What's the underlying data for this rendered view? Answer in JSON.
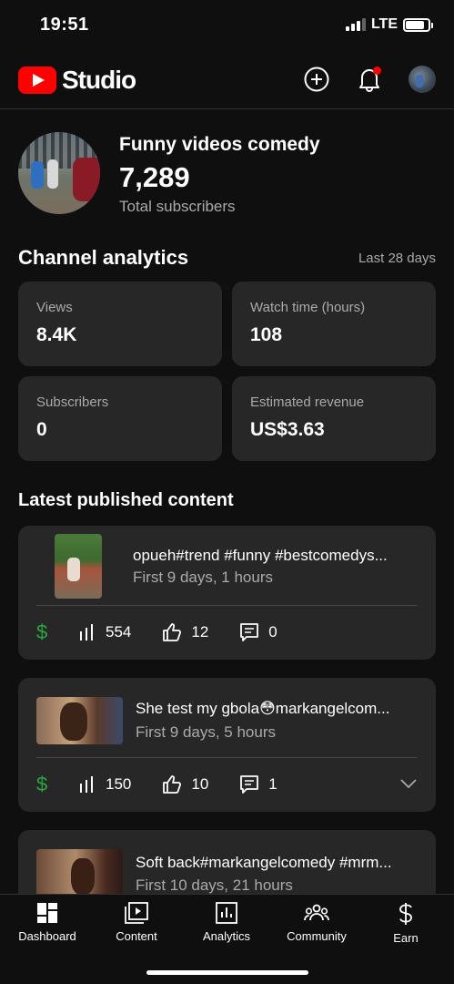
{
  "status_bar": {
    "time": "19:51",
    "network": "LTE",
    "battery_percent": 85,
    "signal_bars": 3
  },
  "header": {
    "logo_text": "Studio",
    "actions": [
      {
        "icon": "create-icon"
      },
      {
        "icon": "notifications-icon",
        "has_badge": true
      },
      {
        "icon": "account-avatar"
      }
    ]
  },
  "channel": {
    "name": "Funny videos comedy",
    "subscriber_count": "7,289",
    "subscriber_label": "Total subscribers"
  },
  "analytics": {
    "title": "Channel analytics",
    "range": "Last 28 days",
    "cards": [
      {
        "label": "Views",
        "value": "8.4K"
      },
      {
        "label": "Watch time (hours)",
        "value": "108"
      },
      {
        "label": "Subscribers",
        "value": "0"
      },
      {
        "label": "Estimated revenue",
        "value": "US$3.63"
      }
    ]
  },
  "latest": {
    "title": "Latest published content",
    "items": [
      {
        "title": "opueh#trend #funny #bestcomedys...",
        "subtitle": "First 9 days, 1 hours",
        "views": "554",
        "likes": "12",
        "comments": "0"
      },
      {
        "title": "She test my gbola😳markangelcom...",
        "subtitle": "First 9 days, 5 hours",
        "views": "150",
        "likes": "10",
        "comments": "1"
      },
      {
        "title": "Soft back#markangelcomedy #mrm...",
        "subtitle": "First 10 days, 21 hours"
      }
    ]
  },
  "bottom_nav": {
    "items": [
      {
        "label": "Dashboard",
        "icon": "dashboard-icon",
        "active": true
      },
      {
        "label": "Content",
        "icon": "content-icon"
      },
      {
        "label": "Analytics",
        "icon": "analytics-icon"
      },
      {
        "label": "Community",
        "icon": "community-icon"
      },
      {
        "label": "Earn",
        "icon": "earn-icon"
      }
    ]
  },
  "colors": {
    "background": "#0f0f0f",
    "card": "#272727",
    "brand_red": "#ff0000",
    "revenue_green": "#2ba640",
    "secondary_text": "#aaaaaa"
  }
}
